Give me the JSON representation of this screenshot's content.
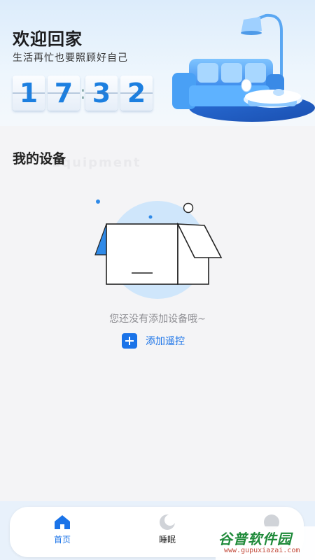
{
  "header": {
    "title": "欢迎回家",
    "subtitle": "生活再忙也要照顾好自己",
    "clock": {
      "h1": "1",
      "h2": "7",
      "m1": "3",
      "m2": "2",
      "separator": ":"
    }
  },
  "devices": {
    "section_title": "我的设备",
    "section_ghost": "Equipment",
    "empty_message": "您还没有添加设备哦~",
    "add_remote_label": "添加遥控"
  },
  "tabbar": {
    "tabs": [
      {
        "label": "首页",
        "icon": "home-icon",
        "active": true
      },
      {
        "label": "睡眠",
        "icon": "moon-icon",
        "active": false
      },
      {
        "label": "",
        "icon": "profile-icon",
        "active": false
      }
    ]
  },
  "watermark": {
    "main": "谷普软件园",
    "sub": "www.gupuxiazai.com"
  },
  "colors": {
    "accent": "#1a73e8",
    "digit": "#1c7fe0",
    "header_bg": "#dcecfb",
    "page_bg": "#f4f4f6"
  }
}
